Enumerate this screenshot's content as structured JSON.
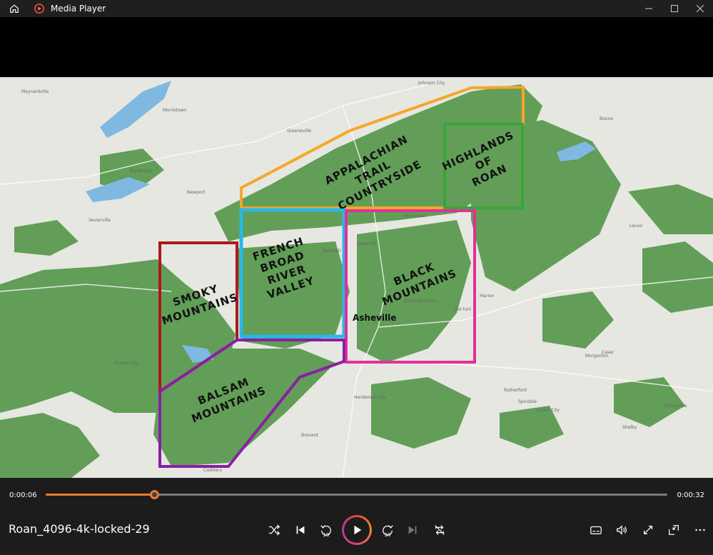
{
  "app": {
    "title": "Media Player"
  },
  "colors": {
    "accent": "#e87b2e",
    "forest": "#5f9b57",
    "water": "#4a9bd8",
    "appalachian": "#f6a72a",
    "highlands": "#3aa63a",
    "french_broad": "#27b8e8",
    "black_mountains": "#e0319a",
    "smoky": "#b01818",
    "balsam": "#8a1fa6"
  },
  "map": {
    "regions": {
      "appalachian": "APPALACHIAN TRAIL COUNTRYSIDE",
      "appalachian_l1": "APPALACHIAN",
      "appalachian_l2": "TRAIL",
      "appalachian_l3": "COUNTRYSIDE",
      "highlands_l1": "HIGHLANDS",
      "highlands_l2": "OF",
      "highlands_l3": "ROAN",
      "french_l1": "FRENCH",
      "french_l2": "BROAD",
      "french_l3": "RIVER",
      "french_l4": "VALLEY",
      "black_l1": "BLACK",
      "black_l2": "MOUNTAINS",
      "smoky_l1": "SMOKY",
      "smoky_l2": "MOUNTAINS",
      "balsam_l1": "BALSAM",
      "balsam_l2": "MOUNTAINS"
    },
    "city": "Asheville",
    "places": {
      "johnson_city": "Johnson City",
      "greeneville": "Greeneville",
      "morristown": "Morristown",
      "newport": "Newport",
      "sevierville": "Sevierville",
      "marshall": "Marshall",
      "burnsville": "Burnsville",
      "marion": "Marion",
      "morganton": "Morganton",
      "shelby": "Shelby",
      "rutherford": "Rutherford",
      "brevard": "Brevard",
      "hendersonville": "Hendersonville",
      "forest_city": "Forest City",
      "lenoir": "Lenoir",
      "boone": "Boone",
      "maynardville": "Maynardville",
      "dandridge": "Dandridge",
      "mars_hill": "Mars Hill",
      "old_fort": "Old Fort",
      "black_mountain": "Black Mountain",
      "spindale": "Spindale",
      "cherryville": "Cherryville",
      "casar": "Casar",
      "bryson": "Bryson City",
      "cashiers": "Cashiers"
    }
  },
  "player": {
    "time_current": "0:00:06",
    "time_total": "0:00:32",
    "progress": 0.175,
    "filename": "Roan_4096-4k-locked-29",
    "skip_back_label": "10",
    "skip_forward_label": "30"
  }
}
